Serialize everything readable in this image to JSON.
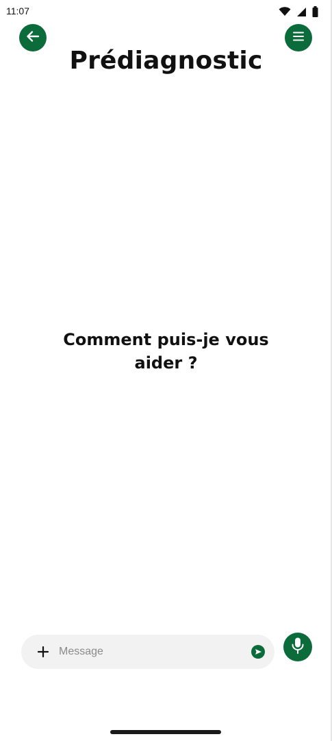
{
  "status_bar": {
    "time": "11:07",
    "icons": [
      "wifi-icon",
      "signal-icon",
      "battery-icon"
    ]
  },
  "header": {
    "back_icon": "arrow-left-icon",
    "menu_icon": "menu-icon",
    "title": "Prédiagnostic"
  },
  "main": {
    "prompt": "Comment puis-je vous aider ?"
  },
  "composer": {
    "attach_icon": "plus-icon",
    "placeholder": "Message",
    "value": "",
    "send_icon": "send-icon",
    "mic_icon": "microphone-icon"
  },
  "colors": {
    "accent": "#0b6b3a",
    "input_background": "#f2f2f2",
    "text": "#111111",
    "placeholder": "#8a8a8a"
  }
}
